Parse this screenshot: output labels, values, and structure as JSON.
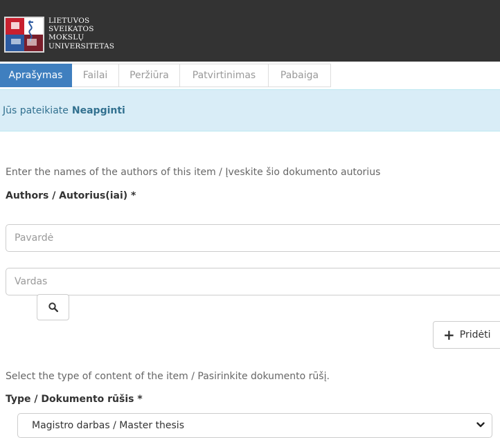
{
  "header": {
    "logo_lines": [
      "LIETUVOS",
      "SVEIKATOS",
      "MOKSLŲ",
      "UNIVERSITETAS"
    ]
  },
  "tabs": [
    {
      "label": "Aprašymas",
      "active": true
    },
    {
      "label": "Failai",
      "active": false
    },
    {
      "label": "Peržiūra",
      "active": false
    },
    {
      "label": "Patvirtinimas",
      "active": false
    },
    {
      "label": "Pabaiga",
      "active": false
    }
  ],
  "alert": {
    "prefix": "Jūs pateikiate",
    "collection": "Neapginti"
  },
  "authors": {
    "hint": "Enter the names of the authors of this item / Įveskite šio dokumento autorius",
    "label": "Authors / Autorius(iai) *",
    "last_name_placeholder": "Pavardė",
    "first_name_placeholder": "Vardas",
    "lookup_icon": "search-icon",
    "add_icon": "plus-icon",
    "add_label": "Pridėti"
  },
  "type": {
    "hint": "Select the type of content of the item / Pasirinkite dokumento rūšį.",
    "label": "Type / Dokumento rūšis *",
    "selected": "Magistro darbas / Master thesis"
  },
  "colors": {
    "header_bg": "#333333",
    "tab_active": "#3f7fbf",
    "alert_bg": "#d9edf7",
    "alert_text": "#31708f"
  }
}
